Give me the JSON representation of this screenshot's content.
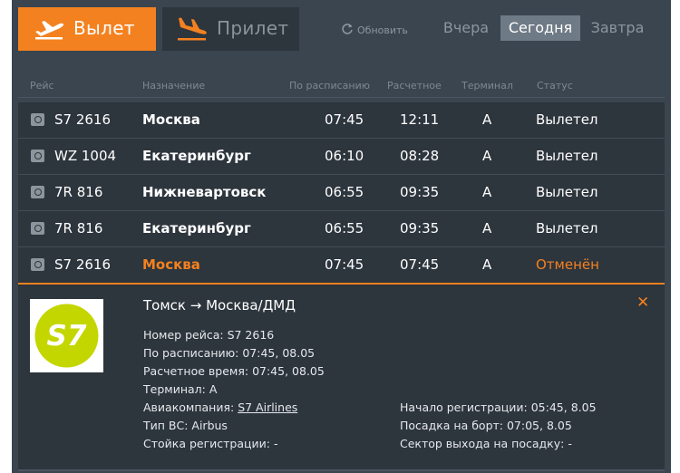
{
  "tabs": {
    "departures": "Вылет",
    "arrivals": "Прилет"
  },
  "refresh_label": "Обновить",
  "days": [
    "Вчера",
    "Сегодня",
    "Завтра"
  ],
  "active_day": "Сегодня",
  "columns": [
    "Рейс",
    "Назначение",
    "По расписанию",
    "Расчетное",
    "Терминал",
    "Статус"
  ],
  "flights": [
    {
      "flight": "S7 2616",
      "destination": "Москва",
      "scheduled": "07:45",
      "estimated": "12:11",
      "terminal": "A",
      "status": "Вылетел"
    },
    {
      "flight": "WZ 1004",
      "destination": "Екатеринбург",
      "scheduled": "06:10",
      "estimated": "08:28",
      "terminal": "A",
      "status": "Вылетел"
    },
    {
      "flight": "7R 816",
      "destination": "Нижневартовск",
      "scheduled": "06:55",
      "estimated": "09:35",
      "terminal": "A",
      "status": "Вылетел"
    },
    {
      "flight": "7R 816",
      "destination": "Екатеринбург",
      "scheduled": "06:55",
      "estimated": "09:35",
      "terminal": "A",
      "status": "Вылетел"
    },
    {
      "flight": "S7 2616",
      "destination": "Москва",
      "scheduled": "07:45",
      "estimated": "07:45",
      "terminal": "A",
      "status": "Отменён"
    }
  ],
  "detail": {
    "airline_logo_text": "S7",
    "route": "Томск → Москва/ДМД",
    "flight_number_label": "Номер рейса:",
    "flight_number": "S7 2616",
    "scheduled_label": "По расписанию:",
    "scheduled": "07:45, 08.05",
    "estimated_label": "Расчетное время:",
    "estimated": "07:45, 08.05",
    "terminal_label": "Терминал:",
    "terminal": "A",
    "airline_label": "Авиакомпания:",
    "airline": "S7 Airlines",
    "aircraft_label": "Тип ВС:",
    "aircraft": "Airbus",
    "checkin_desk_label": "Стойка регистрации:",
    "checkin_desk": "-",
    "checkin_start_label": "Начало регистрации:",
    "checkin_start": "05:45, 8.05",
    "boarding_label": "Посадка на борт:",
    "boarding": "07:05, 8.05",
    "gate_label": "Сектор выхода на посадку:",
    "gate": "-"
  },
  "colors": {
    "accent": "#f4811f",
    "board_bg": "#3a4550",
    "row_bg": "#2d353d",
    "s7_green": "#c4d600"
  },
  "icons": {
    "departures": "plane-takeoff-icon",
    "arrivals": "plane-landing-icon",
    "refresh": "refresh-icon",
    "close": "close-icon",
    "airline": "airline-logo-icon"
  }
}
